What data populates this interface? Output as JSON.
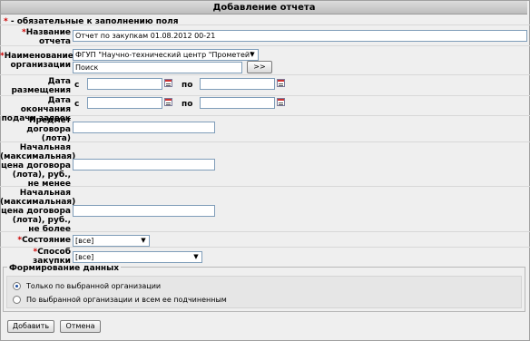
{
  "form": {
    "title": "Добавление отчета",
    "required_note_star": "*",
    "required_note": " - обязательные к заполнению поля",
    "report_name": {
      "label": "Название отчета",
      "value": "Отчет по закупкам 01.08.2012 00-21"
    },
    "organization": {
      "label": "Наименование организации",
      "selected": "ФГУП \"Научно-технический центр \"Прометей\"",
      "search_value": "Поиск",
      "search_button": ">>"
    },
    "placement_date": {
      "label": "Дата размещения",
      "from": "с",
      "to": "по",
      "from_value": "",
      "to_value": ""
    },
    "deadline_date": {
      "label": "Дата окончания подачи заявок",
      "from": "с",
      "to": "по",
      "from_value": "",
      "to_value": ""
    },
    "contract_subject": {
      "label": "Предмет договора (лота)",
      "value": ""
    },
    "price_min": {
      "label": "Начальная (максимальная) цена договора (лота), руб., не менее",
      "value": ""
    },
    "price_max": {
      "label": "Начальная (максимальная) цена договора (лота), руб., не более",
      "value": ""
    },
    "state": {
      "label": "Состояние",
      "selected": "[все]"
    },
    "purchase_method": {
      "label": "Способ закупки",
      "selected": "[все]"
    },
    "data_forming": {
      "legend": "Формирование данных",
      "options": [
        {
          "label": "Только по выбранной организации",
          "checked": true
        },
        {
          "label": "По выбранной организации и всем ее подчиненным",
          "checked": false
        }
      ]
    },
    "buttons": {
      "add": "Добавить",
      "cancel": "Отмена"
    }
  }
}
